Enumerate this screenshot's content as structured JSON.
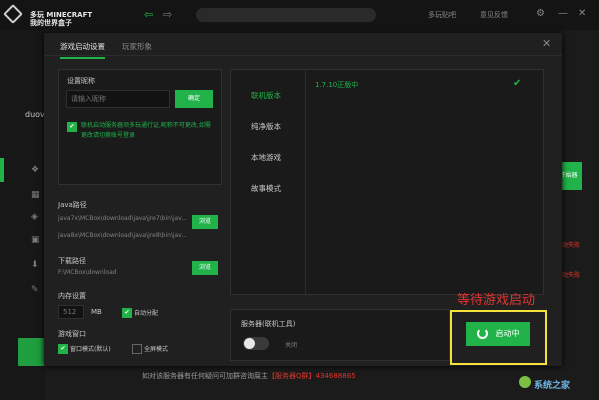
{
  "app": {
    "brand_line1": "多玩 MINECRAFT",
    "brand_line2": "我的世界盒子"
  },
  "topbar": {
    "link1": "多玩贴吧",
    "link2": "意见反馈",
    "gear": "⚙",
    "minimize": "—",
    "close": "✕"
  },
  "sidebar": {
    "username": "duov"
  },
  "dialog": {
    "tabs": [
      "游戏启动设置",
      "玩家形象"
    ],
    "nickname": {
      "title": "设置昵称",
      "placeholder": "请输入昵称",
      "button": "确定",
      "notice": "联机启动服务器须多玩通行证,昵称不可更改,如需更改请切换账号登录"
    },
    "java": {
      "title": "Java路径",
      "path1": "java7x\\MCBox\\download\\java\\jre7\\bin\\jav...",
      "path2": "java8x\\MCBox\\download\\java\\jre8\\bin\\jav...",
      "button": "浏览"
    },
    "download": {
      "title": "下载路径",
      "path": "F:\\MCBox\\download",
      "button": "浏览"
    },
    "memory": {
      "title": "内存设置",
      "value": "512",
      "unit": "MB",
      "auto_label": "自动分配"
    },
    "window": {
      "title": "游戏窗口",
      "option1": "窗口模式(默认)",
      "option2": "全屏模式"
    },
    "categories": [
      "联机版本",
      "纯净版本",
      "本地游戏",
      "故事模式"
    ],
    "selected_version": "1.7.10正版中",
    "check": "✔",
    "server": {
      "label": "服务器(联机工具)",
      "toggle": "关闭"
    },
    "start_button": "启动中",
    "close_icon": "✕"
  },
  "annotation": "等待游戏启动",
  "right": {
    "green_button": "开始器",
    "red1": "启动失败",
    "red2": "启动失败"
  },
  "bottom": {
    "notice": "如对该服务器有任何疑问可加群咨询腐主",
    "group": "【服务器Q群】",
    "qq": "434688865"
  },
  "watermark": "系统之家",
  "colors": {
    "accent": "#21b34a",
    "highlight": "#f4e23a",
    "annotation": "#e3342f"
  }
}
